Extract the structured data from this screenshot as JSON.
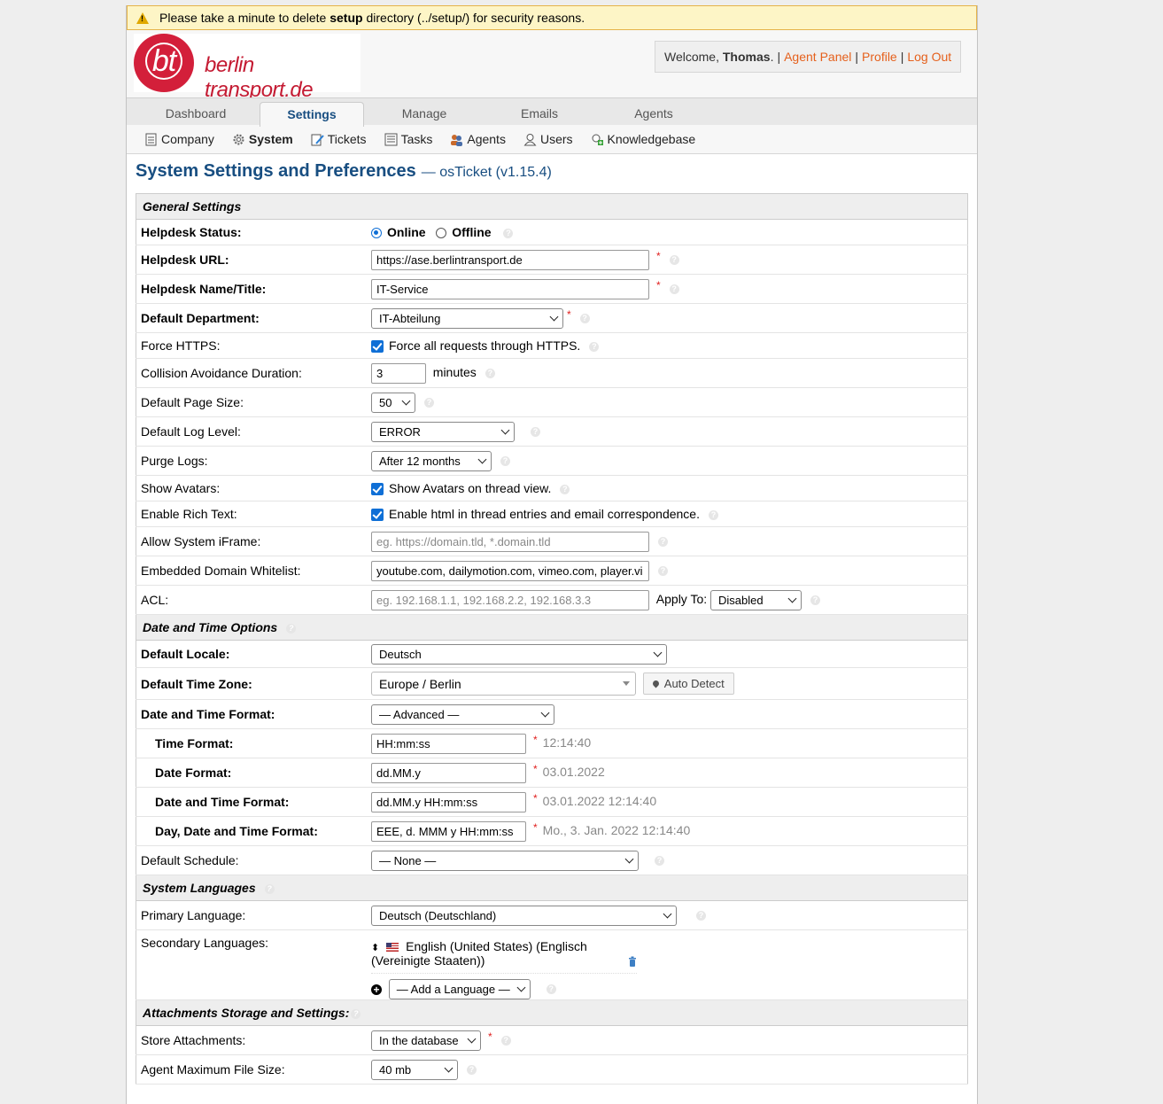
{
  "warning": {
    "before": "Please take a minute to delete ",
    "bold": "setup",
    "after": " directory (../setup/) for security reasons."
  },
  "logo": {
    "mark": "bt",
    "text": "berlin transport.de"
  },
  "welcome": {
    "prefix": "Welcome, ",
    "name": "Thomas",
    "suffix": ".",
    "links": [
      "Agent Panel",
      "Profile",
      "Log Out"
    ]
  },
  "nav": {
    "tabs": [
      "Dashboard",
      "Settings",
      "Manage",
      "Emails",
      "Agents"
    ]
  },
  "subnav": {
    "items": [
      "Company",
      "System",
      "Tickets",
      "Tasks",
      "Agents",
      "Users",
      "Knowledgebase"
    ]
  },
  "page": {
    "title": "System Settings and Preferences",
    "subtitle": "— osTicket (v1.15.4)"
  },
  "general": {
    "header": "General Settings",
    "helpdesk_status": {
      "label": "Helpdesk Status:",
      "online": "Online",
      "offline": "Offline"
    },
    "helpdesk_url": {
      "label": "Helpdesk URL:",
      "value": "https://ase.berlintransport.de"
    },
    "helpdesk_name": {
      "label": "Helpdesk Name/Title:",
      "value": "IT-Service"
    },
    "default_department": {
      "label": "Default Department:",
      "value": "IT-Abteilung"
    },
    "force_https": {
      "label": "Force HTTPS:",
      "text": "Force all requests through HTTPS."
    },
    "collision": {
      "label": "Collision Avoidance Duration:",
      "value": "3",
      "unit": "minutes"
    },
    "page_size": {
      "label": "Default Page Size:",
      "value": "50"
    },
    "log_level": {
      "label": "Default Log Level:",
      "value": "ERROR"
    },
    "purge_logs": {
      "label": "Purge Logs:",
      "value": "After 12 months"
    },
    "show_avatars": {
      "label": "Show Avatars:",
      "text": "Show Avatars on thread view."
    },
    "rich_text": {
      "label": "Enable Rich Text:",
      "text": "Enable html in thread entries and email correspondence."
    },
    "iframe": {
      "label": "Allow System iFrame:",
      "placeholder": "eg. https://domain.tld, *.domain.tld"
    },
    "whitelist": {
      "label": "Embedded Domain Whitelist:",
      "value": "youtube.com, dailymotion.com, vimeo.com, player.vi"
    },
    "acl": {
      "label": "ACL:",
      "placeholder": "eg. 192.168.1.1, 192.168.2.2, 192.168.3.3",
      "apply_label": "Apply To:",
      "apply_value": "Disabled"
    }
  },
  "datetime": {
    "header": "Date and Time Options",
    "locale": {
      "label": "Default Locale:",
      "value": "Deutsch"
    },
    "timezone": {
      "label": "Default Time Zone:",
      "value": "Europe / Berlin",
      "button": "Auto Detect"
    },
    "format": {
      "label": "Date and Time Format:",
      "value": "— Advanced —"
    },
    "time_format": {
      "label": "Time Format:",
      "value": "HH:mm:ss",
      "preview": "12:14:40"
    },
    "date_format": {
      "label": "Date Format:",
      "value": "dd.MM.y",
      "preview": "03.01.2022"
    },
    "datetime_format": {
      "label": "Date and Time Format:",
      "value": "dd.MM.y HH:mm:ss",
      "preview": "03.01.2022 12:14:40"
    },
    "daydatetime_format": {
      "label": "Day, Date and Time Format:",
      "value": "EEE, d. MMM y HH:mm:ss",
      "preview": "Mo., 3. Jan. 2022 12:14:40"
    },
    "schedule": {
      "label": "Default Schedule:",
      "value": "— None —"
    }
  },
  "languages": {
    "header": "System Languages",
    "primary": {
      "label": "Primary Language:",
      "value": "Deutsch (Deutschland)"
    },
    "secondary": {
      "label": "Secondary Languages:",
      "item": "English (United States) (Englisch (Vereinigte Staaten))",
      "add": "— Add a Language —"
    }
  },
  "attachments": {
    "header": "Attachments Storage and Settings:",
    "store": {
      "label": "Store Attachments:",
      "value": "In the database"
    },
    "max_size": {
      "label": "Agent Maximum File Size:",
      "value": "40 mb"
    }
  }
}
